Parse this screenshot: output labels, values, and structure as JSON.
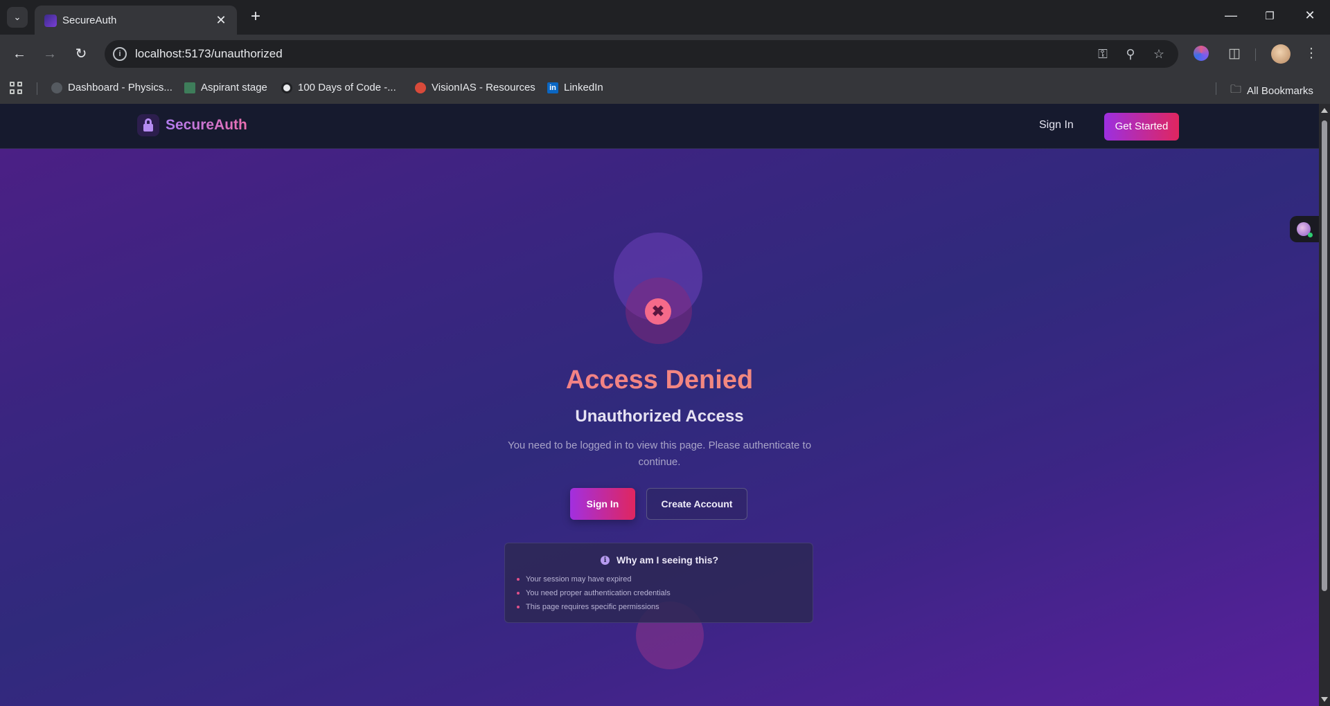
{
  "browser": {
    "tab_title": "SecureAuth",
    "url": "localhost:5173/unauthorized",
    "bookmarks": [
      {
        "label": "Dashboard - Physics...",
        "color": "#555a60"
      },
      {
        "label": "Aspirant stage",
        "color": "#3e7d5a"
      },
      {
        "label": "100 Days of Code -...",
        "color": "#e8eaed"
      },
      {
        "label": "VisionIAS - Resources",
        "color": "#d84a3a"
      },
      {
        "label": "LinkedIn",
        "color": "#0a66c2"
      }
    ],
    "all_bookmarks": "All Bookmarks",
    "linkedin_badge": "in"
  },
  "app": {
    "brand": "SecureAuth",
    "nav": {
      "signin": "Sign In",
      "get_started": "Get Started"
    },
    "error": {
      "icon": "x-icon",
      "title": "Access Denied",
      "subtitle": "Unauthorized Access",
      "description": "You need to be logged in to view this page. Please authenticate to continue."
    },
    "actions": {
      "signin": "Sign In",
      "create_account": "Create Account"
    },
    "why": {
      "title": "Why am I seeing this?",
      "reasons": [
        "Your session may have expired",
        "You need proper authentication credentials",
        "This page requires specific permissions"
      ]
    }
  },
  "colors": {
    "accent_gradient_start": "#a22fe0",
    "accent_gradient_end": "#e0265f",
    "error_red": "#f56a8a"
  }
}
